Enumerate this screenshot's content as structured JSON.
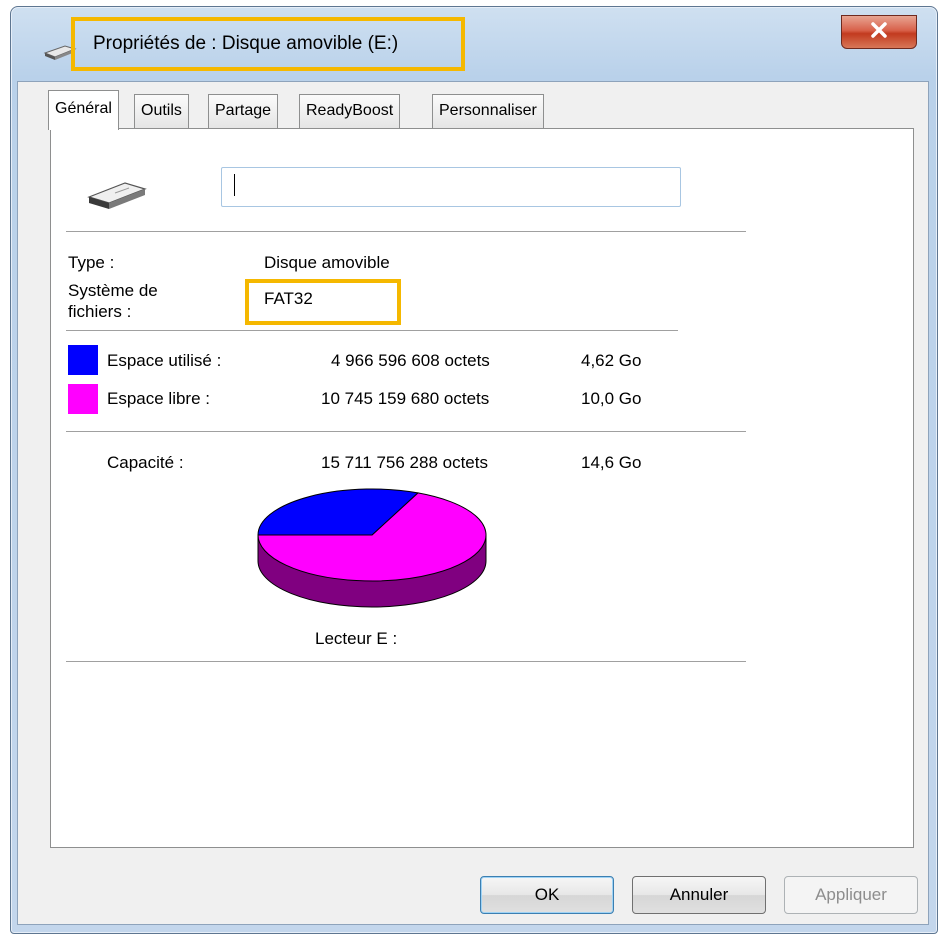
{
  "window": {
    "title": "Propriétés de : Disque amovible (E:)",
    "close_label": "x"
  },
  "tabs": [
    {
      "label": "Général",
      "active": true
    },
    {
      "label": "Outils"
    },
    {
      "label": "Partage"
    },
    {
      "label": "ReadyBoost"
    },
    {
      "label": "Personnaliser"
    }
  ],
  "general": {
    "name_value": "",
    "type_label": "Type :",
    "type_value": "Disque amovible",
    "fs_label_line1": "Système de",
    "fs_label_line2": "fichiers :",
    "fs_value": "FAT32",
    "used_label": "Espace utilisé :",
    "used_bytes": "4 966 596 608 octets",
    "used_size": "4,62 Go",
    "free_label": "Espace libre :",
    "free_bytes": "10 745 159 680 octets",
    "free_size": "10,0 Go",
    "capacity_label": "Capacité :",
    "capacity_bytes": "15 711 756 288 octets",
    "capacity_size": "14,6 Go",
    "drive_label": "Lecteur E :"
  },
  "colors": {
    "used": "#0000ff",
    "free": "#ff00ff",
    "highlight": "#f5b800"
  },
  "disk_usage": {
    "used_fraction": 0.316,
    "free_fraction": 0.684
  },
  "buttons": {
    "ok": "OK",
    "cancel": "Annuler",
    "apply": "Appliquer"
  },
  "icons": {
    "title": "removable-drive-icon",
    "drive": "removable-drive-icon",
    "close": "close-icon"
  }
}
